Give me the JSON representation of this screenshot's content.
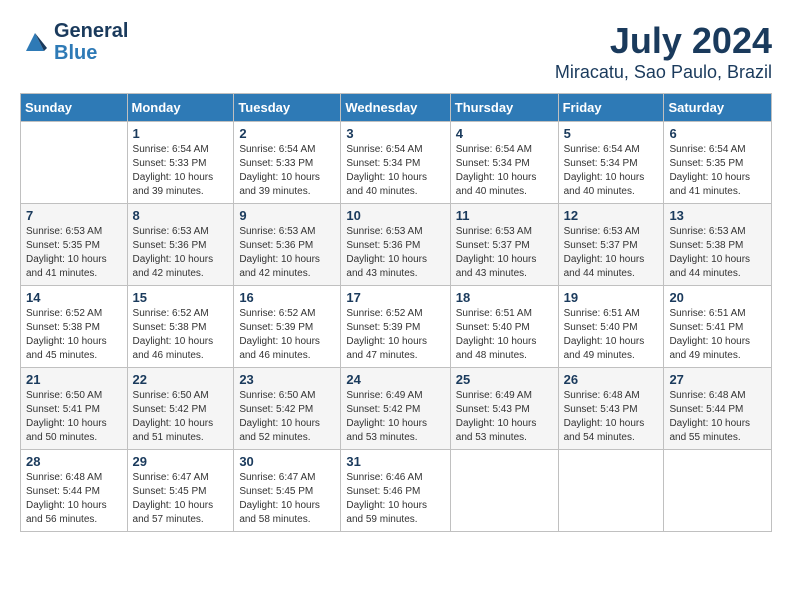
{
  "header": {
    "logo_line1": "General",
    "logo_line2": "Blue",
    "month_year": "July 2024",
    "location": "Miracatu, Sao Paulo, Brazil"
  },
  "columns": [
    "Sunday",
    "Monday",
    "Tuesday",
    "Wednesday",
    "Thursday",
    "Friday",
    "Saturday"
  ],
  "weeks": [
    [
      {
        "day": "",
        "sunrise": "",
        "sunset": "",
        "daylight": ""
      },
      {
        "day": "1",
        "sunrise": "Sunrise: 6:54 AM",
        "sunset": "Sunset: 5:33 PM",
        "daylight": "Daylight: 10 hours and 39 minutes."
      },
      {
        "day": "2",
        "sunrise": "Sunrise: 6:54 AM",
        "sunset": "Sunset: 5:33 PM",
        "daylight": "Daylight: 10 hours and 39 minutes."
      },
      {
        "day": "3",
        "sunrise": "Sunrise: 6:54 AM",
        "sunset": "Sunset: 5:34 PM",
        "daylight": "Daylight: 10 hours and 40 minutes."
      },
      {
        "day": "4",
        "sunrise": "Sunrise: 6:54 AM",
        "sunset": "Sunset: 5:34 PM",
        "daylight": "Daylight: 10 hours and 40 minutes."
      },
      {
        "day": "5",
        "sunrise": "Sunrise: 6:54 AM",
        "sunset": "Sunset: 5:34 PM",
        "daylight": "Daylight: 10 hours and 40 minutes."
      },
      {
        "day": "6",
        "sunrise": "Sunrise: 6:54 AM",
        "sunset": "Sunset: 5:35 PM",
        "daylight": "Daylight: 10 hours and 41 minutes."
      }
    ],
    [
      {
        "day": "7",
        "sunrise": "Sunrise: 6:53 AM",
        "sunset": "Sunset: 5:35 PM",
        "daylight": "Daylight: 10 hours and 41 minutes."
      },
      {
        "day": "8",
        "sunrise": "Sunrise: 6:53 AM",
        "sunset": "Sunset: 5:36 PM",
        "daylight": "Daylight: 10 hours and 42 minutes."
      },
      {
        "day": "9",
        "sunrise": "Sunrise: 6:53 AM",
        "sunset": "Sunset: 5:36 PM",
        "daylight": "Daylight: 10 hours and 42 minutes."
      },
      {
        "day": "10",
        "sunrise": "Sunrise: 6:53 AM",
        "sunset": "Sunset: 5:36 PM",
        "daylight": "Daylight: 10 hours and 43 minutes."
      },
      {
        "day": "11",
        "sunrise": "Sunrise: 6:53 AM",
        "sunset": "Sunset: 5:37 PM",
        "daylight": "Daylight: 10 hours and 43 minutes."
      },
      {
        "day": "12",
        "sunrise": "Sunrise: 6:53 AM",
        "sunset": "Sunset: 5:37 PM",
        "daylight": "Daylight: 10 hours and 44 minutes."
      },
      {
        "day": "13",
        "sunrise": "Sunrise: 6:53 AM",
        "sunset": "Sunset: 5:38 PM",
        "daylight": "Daylight: 10 hours and 44 minutes."
      }
    ],
    [
      {
        "day": "14",
        "sunrise": "Sunrise: 6:52 AM",
        "sunset": "Sunset: 5:38 PM",
        "daylight": "Daylight: 10 hours and 45 minutes."
      },
      {
        "day": "15",
        "sunrise": "Sunrise: 6:52 AM",
        "sunset": "Sunset: 5:38 PM",
        "daylight": "Daylight: 10 hours and 46 minutes."
      },
      {
        "day": "16",
        "sunrise": "Sunrise: 6:52 AM",
        "sunset": "Sunset: 5:39 PM",
        "daylight": "Daylight: 10 hours and 46 minutes."
      },
      {
        "day": "17",
        "sunrise": "Sunrise: 6:52 AM",
        "sunset": "Sunset: 5:39 PM",
        "daylight": "Daylight: 10 hours and 47 minutes."
      },
      {
        "day": "18",
        "sunrise": "Sunrise: 6:51 AM",
        "sunset": "Sunset: 5:40 PM",
        "daylight": "Daylight: 10 hours and 48 minutes."
      },
      {
        "day": "19",
        "sunrise": "Sunrise: 6:51 AM",
        "sunset": "Sunset: 5:40 PM",
        "daylight": "Daylight: 10 hours and 49 minutes."
      },
      {
        "day": "20",
        "sunrise": "Sunrise: 6:51 AM",
        "sunset": "Sunset: 5:41 PM",
        "daylight": "Daylight: 10 hours and 49 minutes."
      }
    ],
    [
      {
        "day": "21",
        "sunrise": "Sunrise: 6:50 AM",
        "sunset": "Sunset: 5:41 PM",
        "daylight": "Daylight: 10 hours and 50 minutes."
      },
      {
        "day": "22",
        "sunrise": "Sunrise: 6:50 AM",
        "sunset": "Sunset: 5:42 PM",
        "daylight": "Daylight: 10 hours and 51 minutes."
      },
      {
        "day": "23",
        "sunrise": "Sunrise: 6:50 AM",
        "sunset": "Sunset: 5:42 PM",
        "daylight": "Daylight: 10 hours and 52 minutes."
      },
      {
        "day": "24",
        "sunrise": "Sunrise: 6:49 AM",
        "sunset": "Sunset: 5:42 PM",
        "daylight": "Daylight: 10 hours and 53 minutes."
      },
      {
        "day": "25",
        "sunrise": "Sunrise: 6:49 AM",
        "sunset": "Sunset: 5:43 PM",
        "daylight": "Daylight: 10 hours and 53 minutes."
      },
      {
        "day": "26",
        "sunrise": "Sunrise: 6:48 AM",
        "sunset": "Sunset: 5:43 PM",
        "daylight": "Daylight: 10 hours and 54 minutes."
      },
      {
        "day": "27",
        "sunrise": "Sunrise: 6:48 AM",
        "sunset": "Sunset: 5:44 PM",
        "daylight": "Daylight: 10 hours and 55 minutes."
      }
    ],
    [
      {
        "day": "28",
        "sunrise": "Sunrise: 6:48 AM",
        "sunset": "Sunset: 5:44 PM",
        "daylight": "Daylight: 10 hours and 56 minutes."
      },
      {
        "day": "29",
        "sunrise": "Sunrise: 6:47 AM",
        "sunset": "Sunset: 5:45 PM",
        "daylight": "Daylight: 10 hours and 57 minutes."
      },
      {
        "day": "30",
        "sunrise": "Sunrise: 6:47 AM",
        "sunset": "Sunset: 5:45 PM",
        "daylight": "Daylight: 10 hours and 58 minutes."
      },
      {
        "day": "31",
        "sunrise": "Sunrise: 6:46 AM",
        "sunset": "Sunset: 5:46 PM",
        "daylight": "Daylight: 10 hours and 59 minutes."
      },
      {
        "day": "",
        "sunrise": "",
        "sunset": "",
        "daylight": ""
      },
      {
        "day": "",
        "sunrise": "",
        "sunset": "",
        "daylight": ""
      },
      {
        "day": "",
        "sunrise": "",
        "sunset": "",
        "daylight": ""
      }
    ]
  ]
}
